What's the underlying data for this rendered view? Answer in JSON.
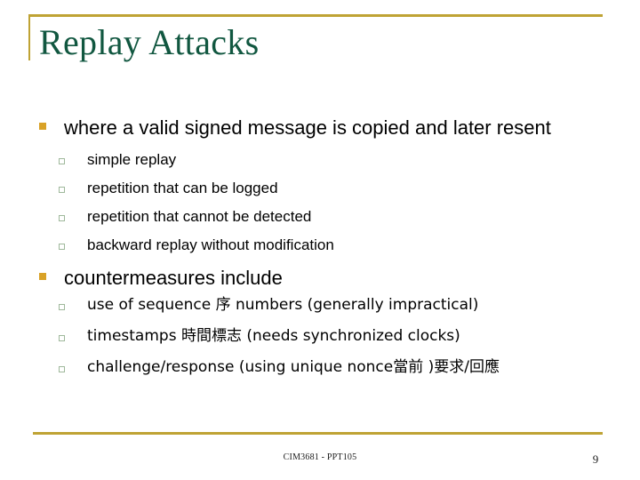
{
  "slide": {
    "title": "Replay Attacks",
    "accent_color": "#bfa334",
    "title_color": "#115740",
    "bullet_level1_color": "#d9a227",
    "bullet_level2_color": "#9fb89b",
    "body_color": "#000000"
  },
  "content": {
    "blocks": [
      {
        "level1": "where a valid signed message is copied and later resent",
        "level2": [
          "simple replay",
          "repetition that can be logged",
          "repetition that cannot be detected",
          "backward replay without modification"
        ]
      },
      {
        "level1": "countermeasures include",
        "level2": [
          "use of sequence 序 numbers (generally impractical)",
          "timestamps 時間標志 (needs synchronized clocks)",
          "challenge/response (using unique nonce當前 )要求/回應"
        ]
      }
    ]
  },
  "footer": {
    "course_code": "CIM3681 - PPT105",
    "page_number": "9"
  }
}
